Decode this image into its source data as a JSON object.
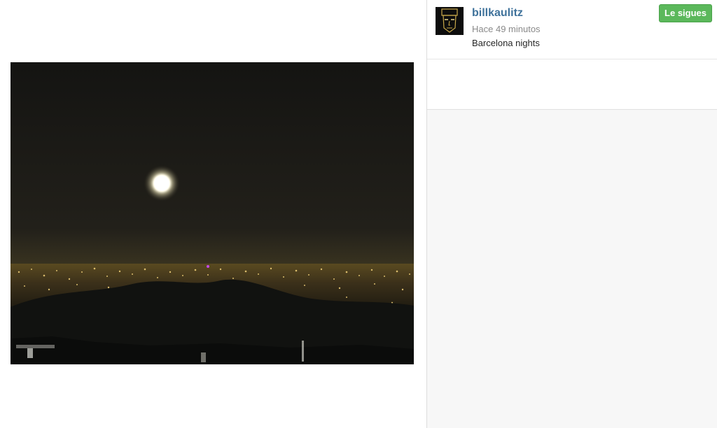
{
  "post": {
    "username": "billkaulitz",
    "time_ago": "Hace 49 minutos",
    "caption": "Barcelona nights",
    "follow_label": "Le sigues"
  },
  "colors": {
    "username": "#3f729b",
    "follow_button": "#5bb85b"
  },
  "icons": {
    "avatar": "user-avatar"
  }
}
